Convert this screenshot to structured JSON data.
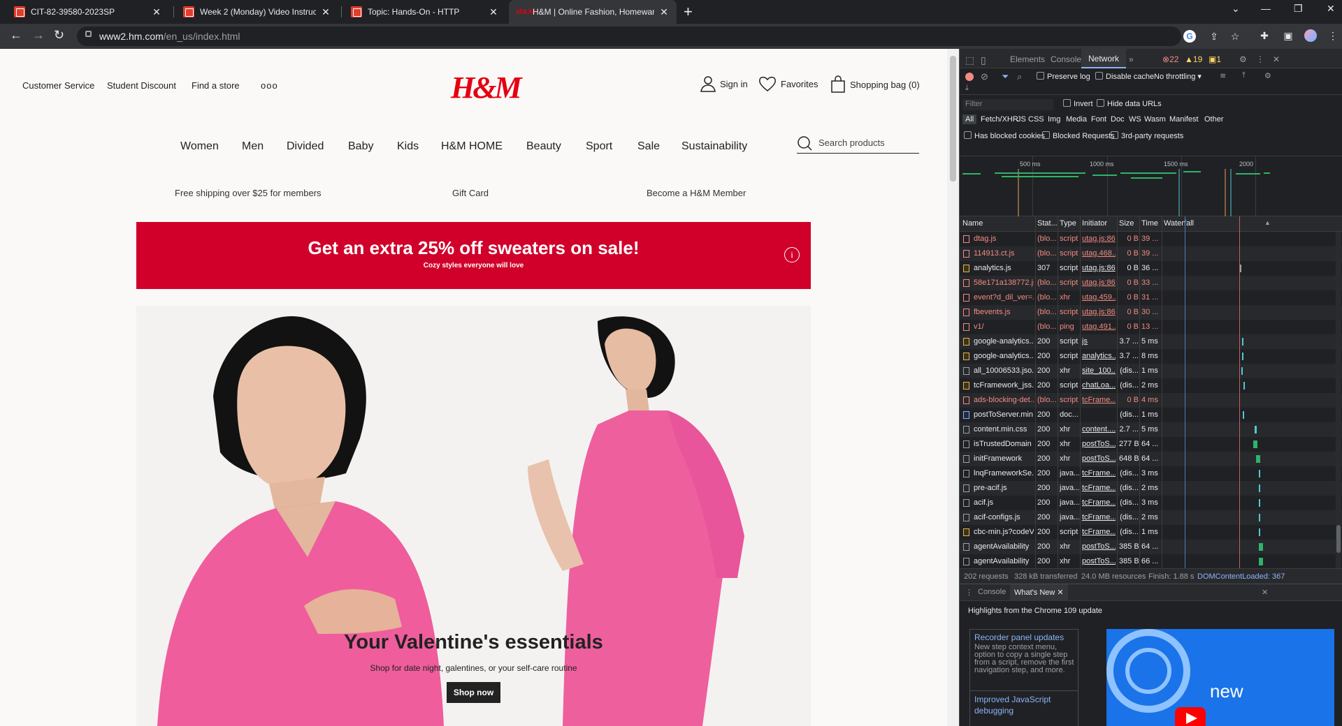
{
  "browser": {
    "tabs": [
      {
        "title": "CIT-82-39580-2023SP",
        "icon": "canvas-icon",
        "active": false
      },
      {
        "title": "Week 2 (Monday) Video Instructi",
        "icon": "canvas-icon",
        "active": false
      },
      {
        "title": "Topic: Hands-On - HTTP",
        "icon": "canvas-icon",
        "active": false
      },
      {
        "title": "H&M | Online Fashion, Homewar",
        "icon": "hm-icon",
        "active": true
      }
    ],
    "favicon_hm_text": "H&M",
    "new_tab": "+",
    "url_host": "www2.hm.com",
    "url_path": "/en_us/index.html"
  },
  "site": {
    "top_links": [
      "Customer Service",
      "Student Discount",
      "Find a store",
      "ooo"
    ],
    "logo": "H&M",
    "account": {
      "signin": "Sign in",
      "favorites": "Favorites",
      "bag": "Shopping bag (0)"
    },
    "nav": [
      "Women",
      "Men",
      "Divided",
      "Baby",
      "Kids",
      "H&M HOME",
      "Beauty",
      "Sport",
      "Sale",
      "Sustainability"
    ],
    "search_placeholder": "Search products",
    "promos": [
      "Free shipping over $25 for members",
      "Gift Card",
      "Become a H&M Member"
    ],
    "banner": {
      "headline": "Get an extra 25% off sweaters on sale!",
      "sub": "Cozy styles everyone will love",
      "info": "i"
    },
    "hero": {
      "title": "Your Valentine's essentials",
      "subtitle": "Shop for date night, galentines, or your self-care routine",
      "cta": "Shop now"
    }
  },
  "devtools": {
    "tabs": [
      "Elements",
      "Console",
      "Network",
      "»"
    ],
    "errors": "22",
    "warnings": "19",
    "issues": "1",
    "toolbar": {
      "preserve_log": "Preserve log",
      "disable_cache": "Disable cache",
      "throttling": "No throttling"
    },
    "filter_placeholder": "Filter",
    "invert": "Invert",
    "hide_data_urls": "Hide data URLs",
    "type_filters": [
      "All",
      "Fetch/XHR",
      "JS",
      "CSS",
      "Img",
      "Media",
      "Font",
      "Doc",
      "WS",
      "Wasm",
      "Manifest",
      "Other"
    ],
    "extra_filters": [
      "Has blocked cookies",
      "Blocked Requests",
      "3rd-party requests"
    ],
    "overview_labels": [
      "500 ms",
      "1000 ms",
      "1500 ms",
      "2000"
    ],
    "columns": [
      "Name",
      "Stat...",
      "Type",
      "Initiator",
      "Size",
      "Time",
      "Waterfall"
    ],
    "rows": [
      {
        "name": "dtag.js",
        "status": "(blo...",
        "type": "script",
        "initiator": "utag.js:86",
        "size": "0 B",
        "time": "39 ...",
        "err": true,
        "kind": "js"
      },
      {
        "name": "114913.ct.js",
        "status": "(blo...",
        "type": "script",
        "initiator": "utag.468...",
        "size": "0 B",
        "time": "39 ...",
        "err": true,
        "kind": "js"
      },
      {
        "name": "analytics.js",
        "status": "307",
        "type": "script",
        "initiator": "utag.js:86",
        "size": "0 B",
        "time": "36 ...",
        "err": false,
        "kind": "js"
      },
      {
        "name": "58e171a138772.js",
        "status": "(blo...",
        "type": "script",
        "initiator": "utag.js:86",
        "size": "0 B",
        "time": "33 ...",
        "err": true,
        "kind": "js"
      },
      {
        "name": "event?d_dil_ver=...",
        "status": "(blo...",
        "type": "xhr",
        "initiator": "utag.459...",
        "size": "0 B",
        "time": "31 ...",
        "err": true,
        "kind": "x"
      },
      {
        "name": "fbevents.js",
        "status": "(blo...",
        "type": "script",
        "initiator": "utag.js:86",
        "size": "0 B",
        "time": "30 ...",
        "err": true,
        "kind": "js"
      },
      {
        "name": "v1/",
        "status": "(blo...",
        "type": "ping",
        "initiator": "utag.491...",
        "size": "0 B",
        "time": "13 ...",
        "err": true,
        "kind": "x"
      },
      {
        "name": "google-analytics....",
        "status": "200",
        "type": "script",
        "initiator": "js",
        "size": "3.7 ...",
        "time": "5 ms",
        "err": false,
        "kind": "js"
      },
      {
        "name": "google-analytics....",
        "status": "200",
        "type": "script",
        "initiator": "analytics....",
        "size": "3.7 ...",
        "time": "8 ms",
        "err": false,
        "kind": "js"
      },
      {
        "name": "all_10006533.jso...",
        "status": "200",
        "type": "xhr",
        "initiator": "site_100...",
        "size": "(dis...",
        "time": "1 ms",
        "err": false,
        "kind": "x"
      },
      {
        "name": "tcFramework_jss...",
        "status": "200",
        "type": "script",
        "initiator": "chatLoa...",
        "size": "(dis...",
        "time": "2 ms",
        "err": false,
        "kind": "js"
      },
      {
        "name": "ads-blocking-det...",
        "status": "(blo...",
        "type": "script",
        "initiator": "tcFrame...",
        "size": "0 B",
        "time": "4 ms",
        "err": true,
        "kind": "js"
      },
      {
        "name": "postToServer.min....",
        "status": "200",
        "type": "doc...",
        "initiator": "",
        "size": "(dis...",
        "time": "1 ms",
        "err": false,
        "kind": "doc"
      },
      {
        "name": "content.min.css",
        "status": "200",
        "type": "xhr",
        "initiator": "content....",
        "size": "2.7 ...",
        "time": "5 ms",
        "err": false,
        "kind": "x"
      },
      {
        "name": "isTrustedDomain",
        "status": "200",
        "type": "xhr",
        "initiator": "postToS...",
        "size": "277 B",
        "time": "64 ...",
        "err": false,
        "kind": "x"
      },
      {
        "name": "initFramework",
        "status": "200",
        "type": "xhr",
        "initiator": "postToS...",
        "size": "648 B",
        "time": "64 ...",
        "err": false,
        "kind": "x"
      },
      {
        "name": "lnqFrameworkSe...",
        "status": "200",
        "type": "java...",
        "initiator": "tcFrame...",
        "size": "(dis...",
        "time": "3 ms",
        "err": false,
        "kind": "x"
      },
      {
        "name": "pre-acif.js",
        "status": "200",
        "type": "java...",
        "initiator": "tcFrame...",
        "size": "(dis...",
        "time": "2 ms",
        "err": false,
        "kind": "x"
      },
      {
        "name": "acif.js",
        "status": "200",
        "type": "java...",
        "initiator": "tcFrame...",
        "size": "(dis...",
        "time": "3 ms",
        "err": false,
        "kind": "x"
      },
      {
        "name": "acif-configs.js",
        "status": "200",
        "type": "java...",
        "initiator": "tcFrame...",
        "size": "(dis...",
        "time": "2 ms",
        "err": false,
        "kind": "x"
      },
      {
        "name": "cbc-min.js?codeV...",
        "status": "200",
        "type": "script",
        "initiator": "tcFrame...",
        "size": "(dis...",
        "time": "1 ms",
        "err": false,
        "kind": "js"
      },
      {
        "name": "agentAvailability",
        "status": "200",
        "type": "xhr",
        "initiator": "postToS...",
        "size": "385 B",
        "time": "64 ...",
        "err": false,
        "kind": "x"
      },
      {
        "name": "agentAvailability",
        "status": "200",
        "type": "xhr",
        "initiator": "postToS...",
        "size": "385 B",
        "time": "66 ...",
        "err": false,
        "kind": "x"
      }
    ],
    "summary": [
      "202 requests",
      "328 kB transferred",
      "24.0 MB resources",
      "Finish: 1.88 s",
      "DOMContentLoaded: 367"
    ],
    "drawer_tabs": [
      "Console",
      "What's New"
    ],
    "whats_new_header": "Highlights from the Chrome 109 update",
    "card1_title": "Recorder panel updates",
    "card1_body": "New step context menu, option to copy a single step from a script, remove the first navigation step, and more.",
    "card2_title": "Improved JavaScript debugging",
    "media_text": "new"
  }
}
